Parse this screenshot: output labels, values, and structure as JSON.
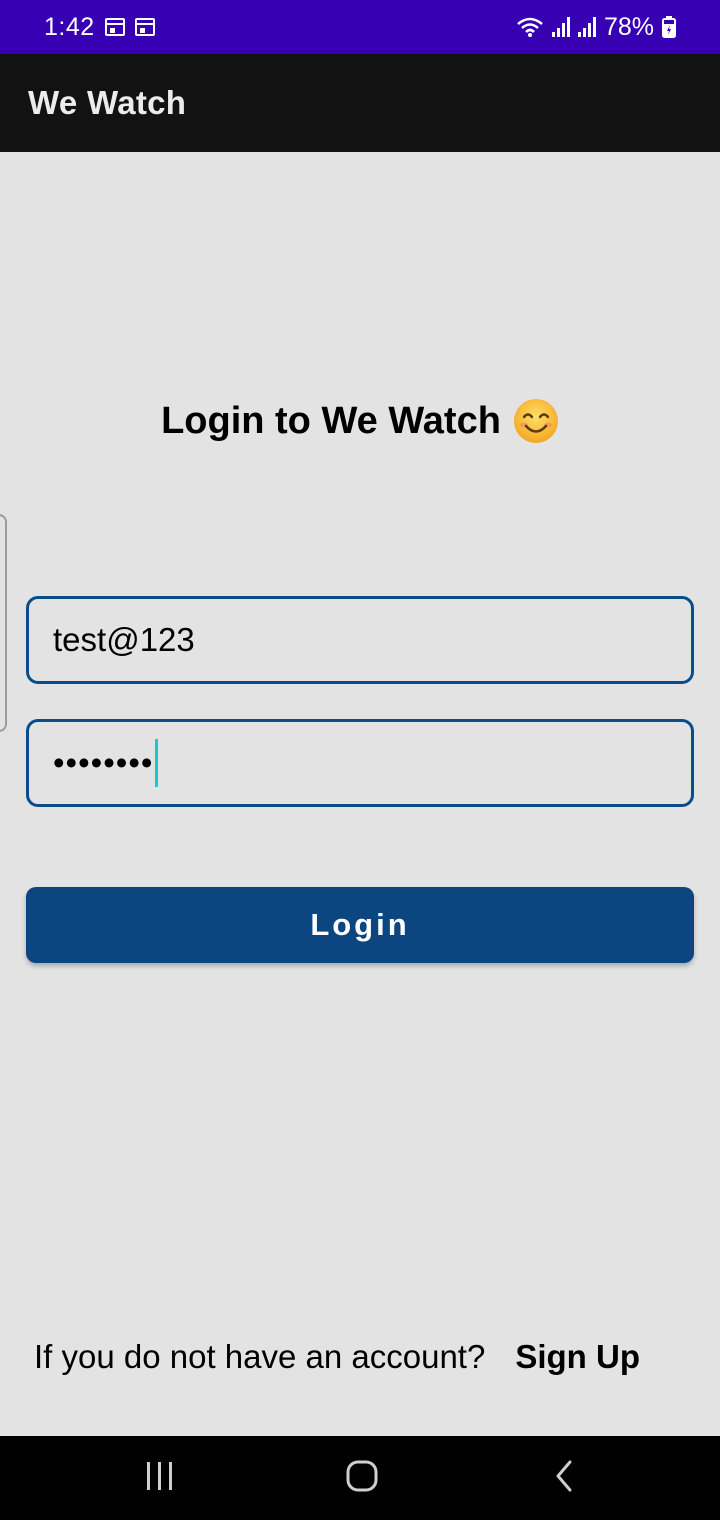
{
  "status_bar": {
    "time": "1:42",
    "battery": "78%",
    "icons": [
      "calendar-icon",
      "calendar-icon",
      "wifi-icon",
      "signal-icon",
      "signal-icon",
      "battery-icon"
    ]
  },
  "app_bar": {
    "title": "We Watch"
  },
  "login": {
    "heading": "Login to We Watch",
    "heading_emoji": "smiling-face-icon",
    "email_value": "test@123",
    "password_value": "••••••••",
    "login_label": "Login"
  },
  "footer": {
    "prompt": "If you do not have an account?",
    "signup_label": "Sign Up"
  },
  "nav_bar": {
    "icons": [
      "recent-apps-icon",
      "home-icon",
      "back-icon"
    ]
  },
  "colors": {
    "status_bar": "#3700b3",
    "app_bar": "#121212",
    "background": "#e4e3e3",
    "primary": "#0b4680",
    "field_border": "#0b4d8a",
    "caret": "#1bc8c8"
  }
}
